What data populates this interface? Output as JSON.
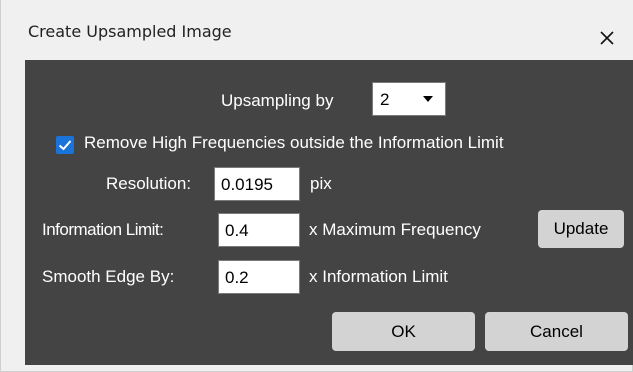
{
  "window": {
    "title": "Create Upsampled Image",
    "close_glyph": "×"
  },
  "upsampling": {
    "label": "Upsampling by",
    "selected": "2"
  },
  "remove_high_freq": {
    "checked": true,
    "label": "Remove High Frequencies outside the Information Limit"
  },
  "resolution": {
    "label": "Resolution:",
    "value": "0.0195",
    "unit": "pix"
  },
  "information_limit": {
    "label": "Information Limit:",
    "value": "0.4",
    "unit": "x Maximum Frequency",
    "update_label": "Update"
  },
  "smooth_edge": {
    "label": "Smooth Edge By:",
    "value": "0.2",
    "unit": "x Information Limit"
  },
  "buttons": {
    "ok_label": "OK",
    "cancel_label": "Cancel"
  },
  "colors": {
    "panel_bg": "#444444",
    "frame_bg": "#f0f0f0",
    "checkbox_accent": "#1a73d9",
    "button_bg": "#d3d3d3"
  },
  "icons": {
    "close": "close-icon",
    "dropdown": "caret-down-icon",
    "check": "checkmark-icon"
  }
}
